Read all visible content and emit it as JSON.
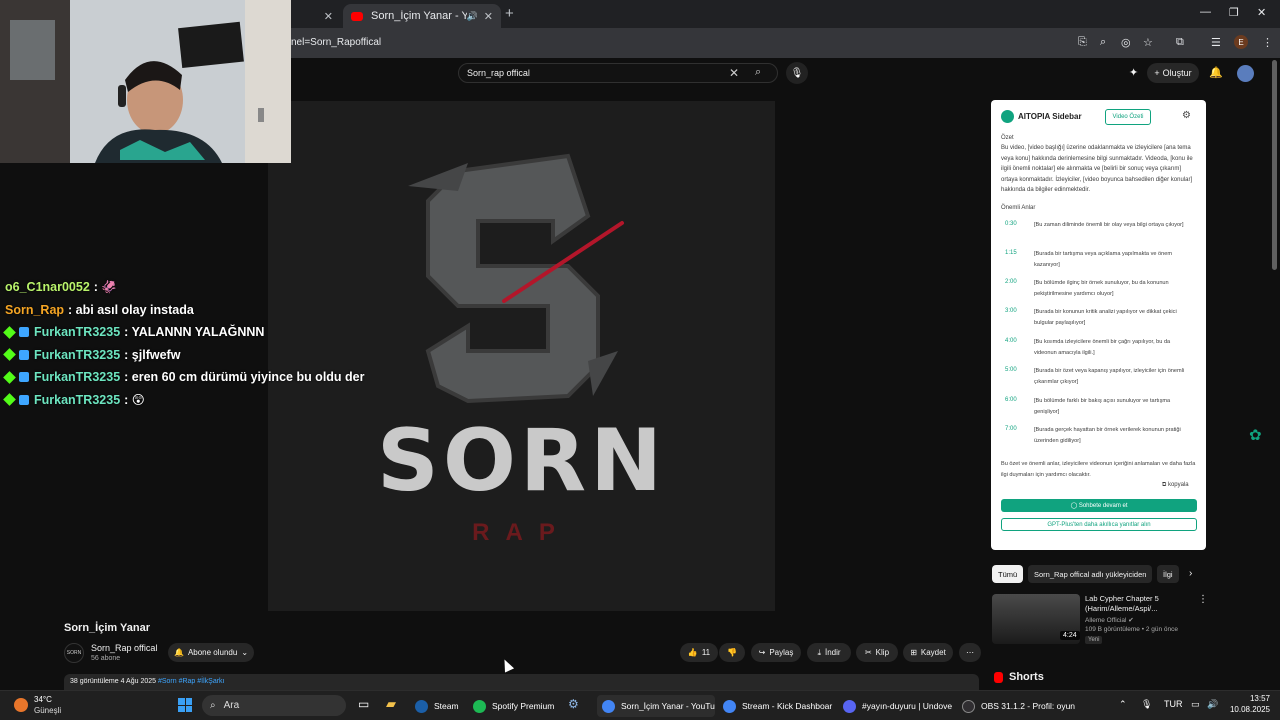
{
  "browser": {
    "tabs": [
      {
        "label": ""
      },
      {
        "label": "Sorn_İçim Yanar - YouTube"
      }
    ],
    "new_tab": "+",
    "url": "nel=Sorn_Rapoffical",
    "profile_initial": "E"
  },
  "youtube": {
    "search_value": "Sorn_rap offical",
    "create_label": "Oluştur",
    "video": {
      "brand": "SORN",
      "brand_sub": "RAP",
      "title": "Sorn_İçim Yanar",
      "channel": "Sorn_Rap offical",
      "channel_avatar_text": "SORN",
      "subscribers": "56 abone",
      "subscribe_state": "Abone olundu",
      "likes": "11",
      "share": "Paylaş",
      "download": "İndir",
      "clip": "Klip",
      "save": "Kaydet",
      "views_date": "38 görüntüleme  4 Ağu 2025",
      "tags": "#Sorn #Rap #İlkŞarkı"
    },
    "chips": [
      "Tümü",
      "Sorn_Rap offical adlı yükleyiciden",
      "İlgi"
    ],
    "recommendation": {
      "title": "Lab Cypher Chapter 5 (Harim/Alleme/Aspi/...",
      "channel": "Alleme Official",
      "meta": "109 B görüntüleme • 2 gün önce",
      "badge": "Yeni",
      "duration": "4:24"
    },
    "shorts_label": "Shorts"
  },
  "aitopia": {
    "title": "AITOPIA Sidebar",
    "summary_button": "Video Özeti",
    "section_summary": "Özet",
    "summary_text": "Bu video, [video başlığı] üzerine odaklanmakta ve izleyicilere [ana tema veya konu] hakkında derinlemesine bilgi sunmaktadır. Videoda, [konu ile ilgili önemli noktalar] ele alınmakta ve [belirli bir sonuç veya çıkarım] ortaya konmaktadır. İzleyiciler, [video boyunca bahsedilen diğer konular] hakkında da bilgiler edinmektedir.",
    "section_moments": "Önemli Anlar",
    "moments": [
      {
        "time": "0:30",
        "text": "[Bu zaman diliminde önemli bir olay veya bilgi ortaya çıkıyor]"
      },
      {
        "time": "1:15",
        "text": "[Burada bir tartışma veya açıklama yapılmakta ve önem kazanıyor]"
      },
      {
        "time": "2:00",
        "text": "[Bu bölümde ilginç bir örnek sunuluyor, bu da konunun pekiştirilmesine yardımcı oluyor]"
      },
      {
        "time": "3:00",
        "text": "[Burada bir konunun kritik analizi yapılıyor ve dikkat çekici bulgular paylaşılıyor]"
      },
      {
        "time": "4:00",
        "text": "[Bu kısımda izleyicilere önemli bir çağrı yapılıyor, bu da videonun amacıyla ilgili.]"
      },
      {
        "time": "5:00",
        "text": "[Burada bir özet veya kapanış yapılıyor, izleyiciler için önemli çıkarımlar çıkıyor]"
      },
      {
        "time": "6:00",
        "text": "[Bu bölümde farklı bir bakış açısı sunuluyor ve tartışma genişliyor]"
      },
      {
        "time": "7:00",
        "text": "[Burada gerçek hayattan bir örnek verilerek konunun pratiği üzerinden gidiliyor]"
      }
    ],
    "footer_text": "Bu özet ve önemli anlar, izleyicilere videonun içeriğini anlamaları ve daha fazla ilgi duymaları için yardımcı olacaktır.",
    "copy_label": "kopyala",
    "continue_label": "Sohbete devam et",
    "plus_label": "GPT-Plus'ten daha akıllıca yanıtlar alın"
  },
  "chat": [
    {
      "user": "o6_C1nar0052",
      "color": "#b9f36b",
      "badge": "none",
      "message": ": 🦑"
    },
    {
      "user": "Sorn_Rap",
      "color": "#f5a524",
      "badge": "none",
      "message": ": abi asıl olay instada"
    },
    {
      "user": "FurkanTR3235",
      "color": "#6de5c0",
      "badge": "both",
      "message": ": YALANNN YALAĞNNN"
    },
    {
      "user": "FurkanTR3235",
      "color": "#6de5c0",
      "badge": "both",
      "message": ": şjlfwefw"
    },
    {
      "user": "FurkanTR3235",
      "color": "#6de5c0",
      "badge": "both",
      "message": ": eren 60 cm dürümü yiyince bu oldu der"
    },
    {
      "user": "FurkanTR3235",
      "color": "#6de5c0",
      "badge": "both",
      "message": ": 😲"
    }
  ],
  "taskbar": {
    "temperature": "34°C",
    "condition": "Güneşli",
    "search_placeholder": "Ara",
    "apps": [
      {
        "label": "Steam",
        "color": "#1b5fa8"
      },
      {
        "label": "Spotify Premium",
        "color": "#1db954"
      },
      {
        "label": "Sorn_İçim Yanar - YouTu",
        "color": "#4285f4"
      },
      {
        "label": "Stream - Kick Dashboar",
        "color": "#4285f4"
      },
      {
        "label": "#yayın-duyuru | Undove",
        "color": "#5865f2"
      },
      {
        "label": "OBS 31.1.2 - Profil: oyun",
        "color": "#302e31"
      }
    ],
    "language": "TUR",
    "time": "13:57",
    "date": "10.08.2025"
  }
}
